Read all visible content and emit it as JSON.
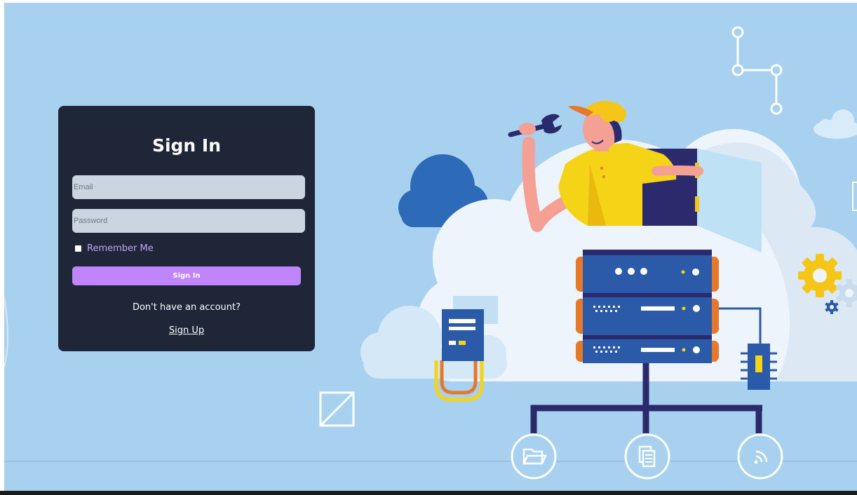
{
  "login": {
    "title": "Sign In",
    "email_placeholder": "Email",
    "password_placeholder": "Password",
    "remember_label": "Remember Me",
    "signin_button": "Sign In",
    "no_account_text": "Don't have an account?",
    "signup_link": "Sign Up"
  },
  "icons": {
    "folder": "folder-icon",
    "documents": "documents-icon",
    "wifi": "wifi-icon",
    "gear": "gear-icon",
    "wrench": "wrench-icon"
  },
  "colors": {
    "background": "#a8d1ef",
    "card": "#1e2638",
    "accent": "#c084fc",
    "remember_text": "#c4a1ff",
    "input": "#cbd5e1",
    "server_blue": "#2b5aa8",
    "server_orange": "#e5782a",
    "worker_shirt": "#f5d316"
  }
}
